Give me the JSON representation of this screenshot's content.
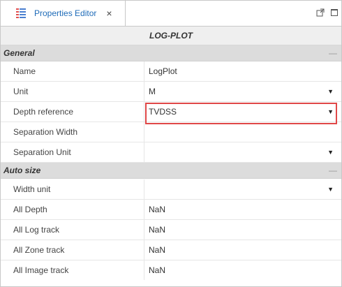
{
  "tab": {
    "label": "Properties Editor",
    "close_glyph": "×",
    "icon": "properties-grid-icon",
    "icon_colors": [
      "#e05050",
      "#4a7fd0"
    ]
  },
  "window_buttons": {
    "popout_icon": "popout-icon",
    "maximize_icon": "maximize-icon"
  },
  "title": "LOG-PLOT",
  "collapse_glyph": "—",
  "dropdown_glyph": "▼",
  "sections": {
    "general": {
      "label": "General",
      "rows": [
        {
          "name": "Name",
          "value": "LogPlot",
          "dropdown": false
        },
        {
          "name": "Unit",
          "value": "M",
          "dropdown": true
        },
        {
          "name": "Depth reference",
          "value": "TVDSS",
          "dropdown": true
        },
        {
          "name": "Separation Width",
          "value": "",
          "dropdown": false
        },
        {
          "name": "Separation Unit",
          "value": "",
          "dropdown": true
        }
      ]
    },
    "auto_size": {
      "label": "Auto size",
      "rows": [
        {
          "name": "Width unit",
          "value": "",
          "dropdown": true
        },
        {
          "name": "All Depth",
          "value": "NaN",
          "dropdown": false
        },
        {
          "name": "All Log track",
          "value": "NaN",
          "dropdown": false
        },
        {
          "name": "All Zone track",
          "value": "NaN",
          "dropdown": false
        },
        {
          "name": "All Image track",
          "value": "NaN",
          "dropdown": false
        }
      ]
    }
  },
  "colors": {
    "tab_label": "#1e6bb8",
    "highlight": "#e04848",
    "section_bg": "#dcdcdc",
    "title_bg": "#efefef"
  }
}
